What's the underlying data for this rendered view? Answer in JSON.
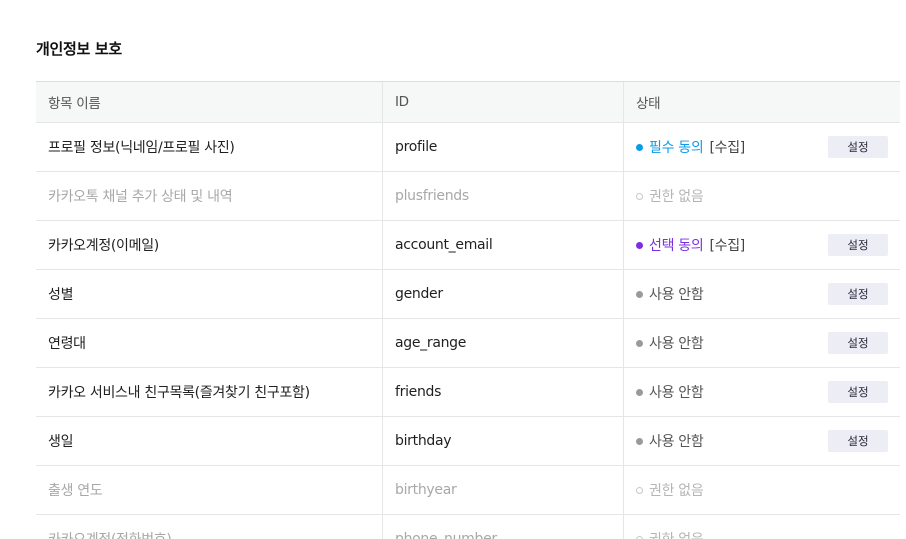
{
  "section": {
    "title": "개인정보 보호"
  },
  "table": {
    "headers": [
      "항목 이름",
      "ID",
      "상태"
    ],
    "rows": [
      {
        "name": "프로필 정보(닉네임/프로필 사진)",
        "id": "profile",
        "status": "필수 동의",
        "collect": "[수집]",
        "button": "설정"
      },
      {
        "name": "카카오톡 채널 추가 상태 및 내역",
        "id": "plusfriends",
        "status": "권한 없음"
      },
      {
        "name": "카카오계정(이메일)",
        "id": "account_email",
        "status": "선택 동의",
        "collect": "[수집]",
        "button": "설정"
      },
      {
        "name": "성별",
        "id": "gender",
        "status": "사용 안함",
        "button": "설정"
      },
      {
        "name": "연령대",
        "id": "age_range",
        "status": "사용 안함",
        "button": "설정"
      },
      {
        "name": "카카오 서비스내 친구목록(즐겨찾기 친구포함)",
        "id": "friends",
        "status": "사용 안함",
        "button": "설정"
      },
      {
        "name": "생일",
        "id": "birthday",
        "status": "사용 안함",
        "button": "설정"
      },
      {
        "name": "출생 연도",
        "id": "birthyear",
        "status": "권한 없음"
      },
      {
        "name": "카카오계정(전화번호)",
        "id": "phone_number",
        "status": "권한 없음"
      }
    ]
  },
  "colors": {
    "required": "#0d9be8",
    "optional": "#7c2fe0",
    "unused": "#9a9a9a",
    "no_permission": "#c8c8c8"
  }
}
